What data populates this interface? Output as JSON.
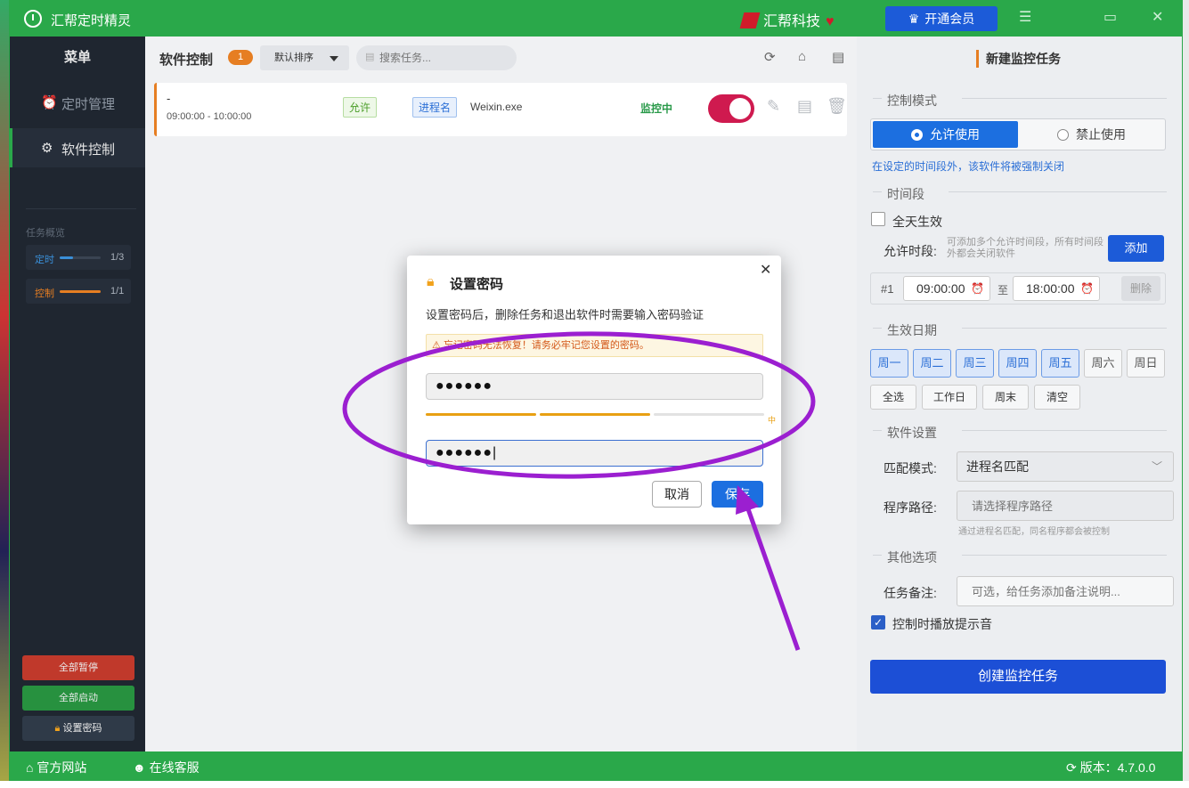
{
  "window": {
    "title": "汇帮定时精灵",
    "brand": "汇帮科技",
    "vip_label": "开通会员"
  },
  "sidebar": {
    "menu_title": "菜单",
    "items": [
      {
        "label": "定时管理",
        "icon": "alarm-clock-icon"
      },
      {
        "label": "软件控制",
        "icon": "gear-icon"
      }
    ],
    "overview_title": "任务概览",
    "overview": [
      {
        "label": "定时",
        "count": "1/3",
        "progress": 0.33,
        "color": "#3a8fd8"
      },
      {
        "label": "控制",
        "count": "1/1",
        "progress": 1.0,
        "color": "#e67e22"
      }
    ],
    "buttons": {
      "pause_all": "全部暂停",
      "start_all": "全部启动",
      "set_password": "设置密码"
    }
  },
  "main": {
    "title": "软件控制",
    "badge": "1",
    "sort_label": "默认排序",
    "search_placeholder": "搜索任务...",
    "task": {
      "name": "-",
      "time": "09:00:00 - 10:00:00",
      "mode_tag": "允许",
      "match_tag": "进程名",
      "process": "Weixin.exe",
      "status": "监控中",
      "enabled": true
    }
  },
  "panel": {
    "title": "新建监控任务",
    "section_mode": "控制模式",
    "mode_allow": "允许使用",
    "mode_deny": "禁止使用",
    "mode_hint": "在设定的时间段外，该软件将被强制关闭",
    "section_time": "时间段",
    "all_day_label": "全天生效",
    "all_day_checked": false,
    "allow_period_label": "允许时段:",
    "allow_period_hint": "可添加多个允许时间段，所有时间段外都会关闭软件",
    "add_label": "添加",
    "slot_num": "#1",
    "slot_start": "09:00:00",
    "slot_to": "至",
    "slot_end": "18:00:00",
    "slot_delete": "删除",
    "section_days": "生效日期",
    "days": [
      {
        "label": "周一",
        "on": true
      },
      {
        "label": "周二",
        "on": true
      },
      {
        "label": "周三",
        "on": true
      },
      {
        "label": "周四",
        "on": true
      },
      {
        "label": "周五",
        "on": true
      },
      {
        "label": "周六",
        "on": false
      },
      {
        "label": "周日",
        "on": false
      }
    ],
    "quick": [
      "全选",
      "工作日",
      "周末",
      "清空"
    ],
    "section_software": "软件设置",
    "match_mode_label": "匹配模式:",
    "match_mode_value": "进程名匹配",
    "path_label": "程序路径:",
    "path_placeholder": "请选择程序路径",
    "path_hint": "通过进程名匹配，同名程序都会被控制",
    "section_other": "其他选项",
    "note_label": "任务备注:",
    "note_placeholder": "可选，给任务添加备注说明...",
    "sound_label": "控制时播放提示音",
    "sound_checked": true,
    "create_label": "创建监控任务"
  },
  "statusbar": {
    "website": "官方网站",
    "support": "在线客服",
    "version": "版本：4.7.0.0"
  },
  "dialog": {
    "title": "设置密码",
    "desc": "设置密码后，删除任务和退出软件时需要输入密码验证",
    "warning": "忘记密码无法恢复！请务必牢记您设置的密码。",
    "password_mask": "●●●●●●",
    "confirm_mask": "●●●●●●",
    "strength_label": "中",
    "strength_level": 2,
    "strength_levels": 3,
    "cancel_label": "取消",
    "save_label": "保存"
  },
  "colors": {
    "titlebar": "#2aa84a",
    "primary": "#1c6fe0",
    "accent": "#e67e22",
    "annotation": "#9b1fd0"
  }
}
